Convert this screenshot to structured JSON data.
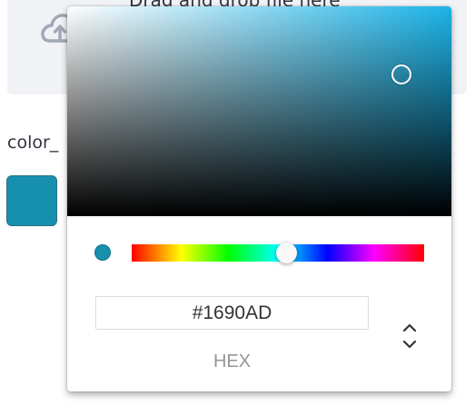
{
  "uploader": {
    "icon": "cloud-upload-icon",
    "text": "Drag and drop file here"
  },
  "color_field": {
    "label": "color_",
    "value": "#1690AD"
  },
  "picker": {
    "saturation_hue_color": "#1CB4E8",
    "current_color": "#1690AD",
    "hue_slider_level": 0.53,
    "hex_value": "#1690AD",
    "mode_label": "HEX",
    "toggle_icon": "chevron-up-down-icon"
  }
}
